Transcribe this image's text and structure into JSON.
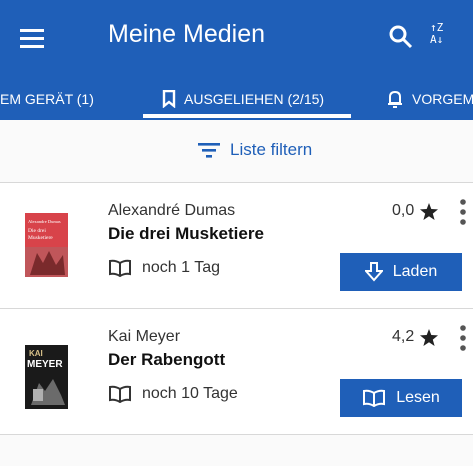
{
  "appbar": {
    "title": "Meine Medien",
    "sort_label_top": "↑Z",
    "sort_label_bottom": "A↓"
  },
  "tabs": [
    {
      "label": "EM GERÄT (1)"
    },
    {
      "label": "AUSGELIEHEN (2/15)"
    },
    {
      "label": "VORGEM"
    }
  ],
  "filter": {
    "label": "Liste filtern"
  },
  "books": [
    {
      "author": "Alexandré Dumas",
      "title": "Die drei Musketiere",
      "rating": "0,0",
      "loan": "noch 1 Tag",
      "action": "Laden",
      "cover_text_1": "Alexandre Dumas",
      "cover_text_2": "Die drei",
      "cover_text_3": "Musketiere"
    },
    {
      "author": "Kai Meyer",
      "title": "Der Rabengott",
      "rating": "4,2",
      "loan": "noch 10 Tage",
      "action": "Lesen",
      "cover_text_1": "KAI",
      "cover_text_2": "MEYER"
    }
  ],
  "colors": {
    "primary": "#1f5fb8",
    "highlight": "#e2231a"
  }
}
